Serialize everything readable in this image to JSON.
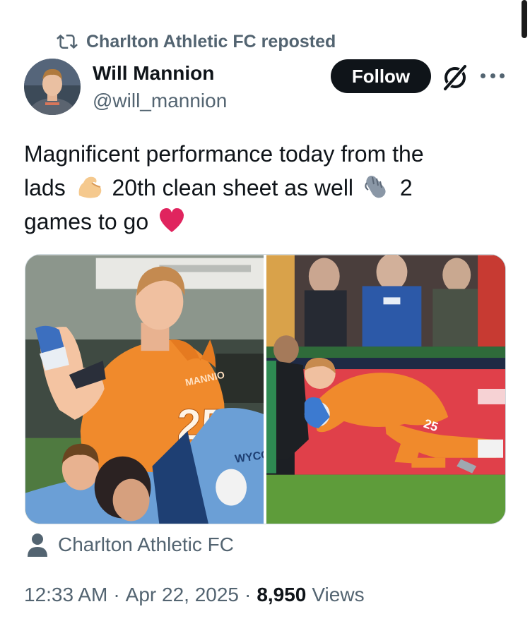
{
  "repost": {
    "label": "Charlton Athletic FC reposted"
  },
  "author": {
    "name": "Will Mannion",
    "handle": "@will_mannion"
  },
  "actions": {
    "follow_label": "Follow"
  },
  "tweet": {
    "line1": "Magnificent performance today from the",
    "line2_a": "lads",
    "line2_b": "20th clean sheet as well",
    "line2_c": "2",
    "line3": "games to go"
  },
  "location": {
    "label": "Charlton Athletic FC"
  },
  "meta": {
    "time": "12:33 AM",
    "separator": "·",
    "date": "Apr 22, 2025",
    "views_count": "8,950",
    "views_label": "Views"
  },
  "media": {
    "photo1_shirt_text": "MANNIO",
    "photo1_number": "25",
    "photo1_flag_text": "WYCO",
    "photo2_shirt_number": "25"
  },
  "colors": {
    "text": "#0f1419",
    "secondary": "#536471",
    "follow_bg": "#0f1419",
    "kit_orange": "#f08a2c",
    "heart": "#e0245e"
  },
  "icons": [
    "repost-icon",
    "grok-icon",
    "more-icon",
    "flexed-biceps-emoji",
    "gloves-emoji",
    "heart-emoji",
    "person-icon"
  ]
}
